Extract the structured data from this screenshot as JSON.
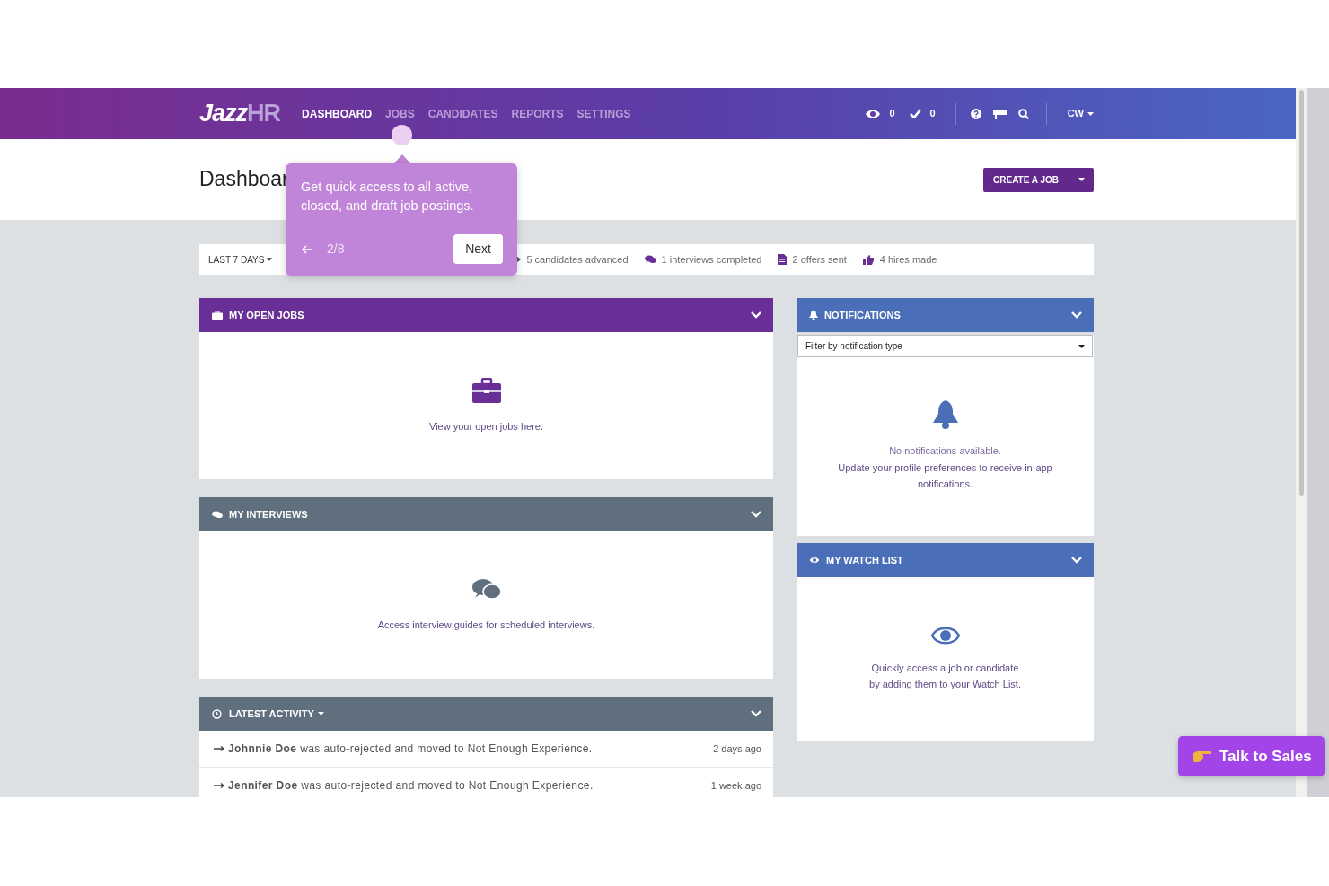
{
  "navbar": {
    "logo": {
      "main": "Jazz",
      "accent": "HR"
    },
    "items": [
      {
        "label": "DASHBOARD",
        "selected": true
      },
      {
        "label": "JOBS",
        "selected": false
      },
      {
        "label": "CANDIDATES",
        "selected": false
      },
      {
        "label": "REPORTS",
        "selected": false
      },
      {
        "label": "SETTINGS",
        "selected": false
      }
    ],
    "counters": [
      {
        "kind": "eye",
        "count": "0"
      },
      {
        "kind": "check",
        "count": "0"
      }
    ],
    "tools": [
      {
        "kind": "help"
      },
      {
        "kind": "cap"
      },
      {
        "kind": "search"
      }
    ],
    "user": "CW"
  },
  "header": {
    "title": "Dashboar",
    "button": "CREATE A JOB"
  },
  "stats": {
    "range": "LAST 7 DAYS",
    "items": [
      {
        "kind": "advance",
        "text": "5 candidates advanced"
      },
      {
        "kind": "chat",
        "text": "1 interviews completed"
      },
      {
        "kind": "document",
        "text": "2 offers sent"
      },
      {
        "kind": "thumb",
        "text": "4 hires made"
      }
    ]
  },
  "left_panels": [
    {
      "kind": "jobs",
      "title": "MY OPEN JOBS",
      "message": "View your open jobs here."
    },
    {
      "kind": "interviews",
      "title": "MY INTERVIEWS",
      "message": "Access interview guides for scheduled interviews."
    }
  ],
  "activity": {
    "title": "LATEST ACTIVITY",
    "rows": [
      {
        "name": "Johnnie Doe",
        "text": "was auto-rejected and moved to Not Enough Experience.",
        "time": "2 days ago"
      },
      {
        "name": "Jennifer Doe",
        "text": "was auto-rejected and moved to Not Enough Experience.",
        "time": "1 week ago"
      }
    ]
  },
  "notifications": {
    "title": "NOTIFICATIONS",
    "filter": "Filter by notification type",
    "message": "No notifications available.",
    "detail": "Update your profile preferences to receive in-app notifications."
  },
  "watch_list": {
    "title": "MY WATCH LIST",
    "message": "Quickly access a job or candidate",
    "detail": "by adding them to your Watch List."
  },
  "tour": {
    "text": "Get quick access to all active, closed, and draft job postings.",
    "step": "2/8",
    "next": "Next"
  },
  "sales_button": "Talk to Sales"
}
